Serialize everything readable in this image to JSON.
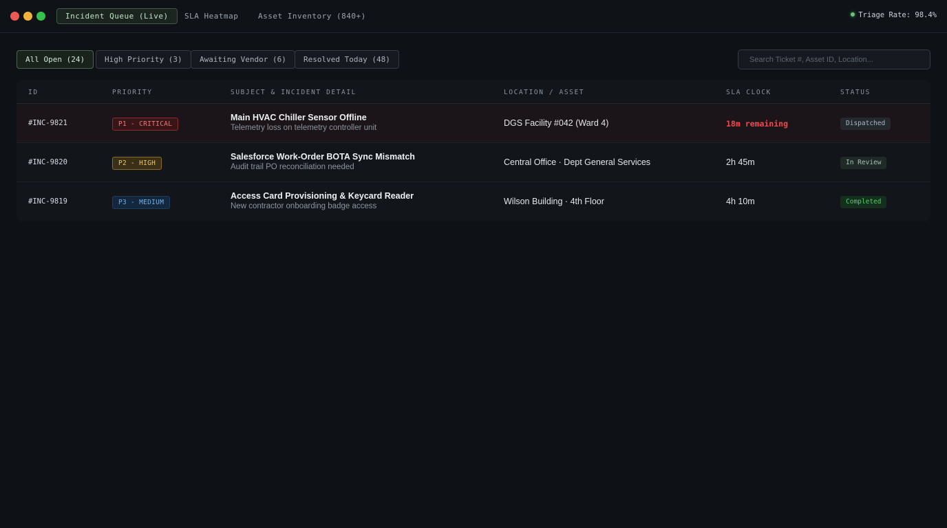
{
  "window": {
    "nav_tabs": [
      {
        "label": "Incident Queue (Live)",
        "active": true
      },
      {
        "label": "SLA Heatmap",
        "active": false
      },
      {
        "label": "Asset Inventory (840+)",
        "active": false
      }
    ],
    "triage_rate": "Triage Rate: 98.4%"
  },
  "filters": {
    "chips": [
      {
        "label": "All Open (24)",
        "active": true
      },
      {
        "label": "High Priority (3)",
        "active": false
      },
      {
        "label": "Awaiting Vendor (6)",
        "active": false
      },
      {
        "label": "Resolved Today (48)",
        "active": false
      }
    ],
    "search_placeholder": "Search Ticket #, Asset ID, Location..."
  },
  "table": {
    "headers": {
      "id": "ID",
      "priority": "PRIORITY",
      "subject": "SUBJECT & INCIDENT DETAIL",
      "location": "LOCATION / ASSET",
      "sla": "SLA CLOCK",
      "status": "STATUS"
    },
    "rows": [
      {
        "id": "#INC-9821",
        "priority": "P1 - CRITICAL",
        "priority_level": "critical",
        "title": "Main HVAC Chiller Sensor Offline",
        "detail": "Telemetry loss on telemetry controller unit",
        "location": "DGS Facility #042 (Ward 4)",
        "sla": "18m remaining",
        "sla_urgent": true,
        "status": "Dispatched"
      },
      {
        "id": "#INC-9820",
        "priority": "P2 - HIGH",
        "priority_level": "high",
        "title": "Salesforce Work-Order BOTA Sync Mismatch",
        "detail": "Audit trail PO reconciliation needed",
        "location": "Central Office · Dept General Services",
        "sla": "2h 45m",
        "sla_urgent": false,
        "status": "In Review"
      },
      {
        "id": "#INC-9819",
        "priority": "P3 - MEDIUM",
        "priority_level": "medium",
        "title": "Access Card Provisioning & Keycard Reader",
        "detail": "New contractor onboarding badge access",
        "location": "Wilson Building · 4th Floor",
        "sla": "4h 10m",
        "sla_urgent": false,
        "status": "Completed"
      }
    ]
  },
  "colors": {
    "background": "#0e1116",
    "accent_green": "#6fbf7a",
    "critical_red": "#f04a4f",
    "high_amber": "#f0c45d",
    "medium_blue": "#6fb0ea"
  }
}
